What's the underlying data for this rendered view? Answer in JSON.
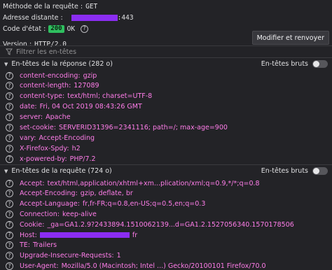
{
  "summary": {
    "method_label": "Méthode de la requête :",
    "method_value": "GET",
    "address_label": "Adresse distante :",
    "address_port": ":443",
    "status_label": "Code d'état :",
    "status_code": "200",
    "status_text": "OK",
    "version_label": "Version :",
    "version_value": "HTTP/2.0",
    "resend_label": "Modifier et renvoyer"
  },
  "filter": {
    "placeholder": "Filtrer les en-têtes"
  },
  "response": {
    "title": "En-têtes de la réponse (282 o)",
    "raw_label": "En-têtes bruts",
    "headers": [
      {
        "name": "content-encoding:",
        "value": "gzip"
      },
      {
        "name": "content-length:",
        "value": "127089"
      },
      {
        "name": "content-type:",
        "value": "text/html; charset=UTF-8"
      },
      {
        "name": "date:",
        "value": "Fri, 04 Oct 2019 08:43:26 GMT"
      },
      {
        "name": "server:",
        "value": "Apache"
      },
      {
        "name": "set-cookie:",
        "value": "SERVERID31396=2341116; path=/; max-age=900"
      },
      {
        "name": "vary:",
        "value": "Accept-Encoding"
      },
      {
        "name": "X-Firefox-Spdy:",
        "value": "h2"
      },
      {
        "name": "x-powered-by:",
        "value": "PHP/7.2"
      }
    ]
  },
  "request": {
    "title": "En-têtes de la requête (724 o)",
    "raw_label": "En-têtes bruts",
    "headers": [
      {
        "name": "Accept:",
        "value": "text/html,application/xhtml+xm...plication/xml;q=0.9,*/*;q=0.8"
      },
      {
        "name": "Accept-Encoding:",
        "value": "gzip, deflate, br"
      },
      {
        "name": "Accept-Language:",
        "value": "fr,fr-FR;q=0.8,en-US;q=0.5,en;q=0.3"
      },
      {
        "name": "Connection:",
        "value": "keep-alive"
      },
      {
        "name": "Cookie:",
        "value": "_ga=GA1.2.9?2433894.1510062139...d=GA1.2.1527056340.1570178506"
      },
      {
        "name": "Host:",
        "value": "fr"
      },
      {
        "name": "TE:",
        "value": "Trailers"
      },
      {
        "name": "Upgrade-Insecure-Requests:",
        "value": "1"
      },
      {
        "name": "User-Agent:",
        "value": "Mozilla/5.0 (Macintosh; Intel ...) Gecko/20100101 Firefox/70.0"
      }
    ]
  },
  "icons": {
    "help": "question-circle-icon",
    "filter": "funnel-icon",
    "collapse": "triangle-down-icon"
  },
  "colors": {
    "background": "#232327",
    "header_text": "#ff7de9",
    "status_badge": "#2fbf5f",
    "redaction": "#8b2df2"
  }
}
